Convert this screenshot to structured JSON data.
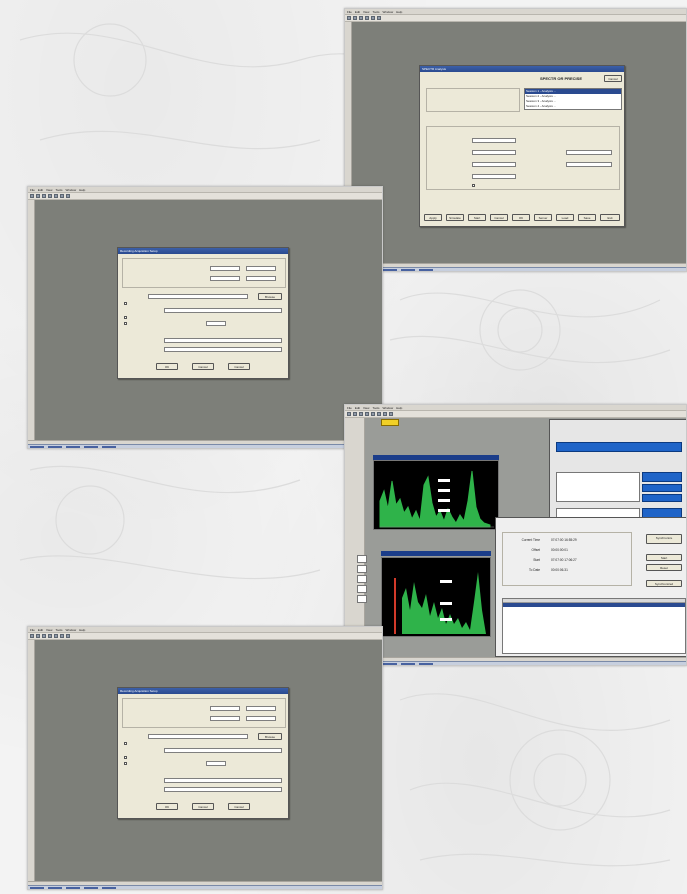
{
  "screens": {
    "top_right": {
      "dialog": {
        "title": "SPECTR Analysis",
        "heading": "SPECTR OR PRECISE",
        "cancel_label": "Cancel",
        "list_items": [
          "Session 1 - Analysis ...",
          "Session 2 - Analysis ...",
          "Session 3 - Analysis ...",
          "Session 4 - Analysis ..."
        ],
        "bottom_buttons": [
          "Apply",
          "Simulate",
          "Start",
          "Cancel",
          "OK",
          "Server",
          "Load",
          "Save",
          "Exit"
        ]
      }
    },
    "middle_left": {
      "dialog": {
        "title": "Recording Acquisition Setup",
        "ok_label": "OK",
        "cancel_label": "Cancel",
        "help_label": "Cancel",
        "browse_label": "Browse"
      }
    },
    "right_analyzer": {
      "result_panel": {
        "rows": [
          {
            "label": "Current Time",
            "value": "07:07:00 16:55:29"
          },
          {
            "label": "Offset",
            "value": "00:00:00:01"
          },
          {
            "label": "Start",
            "value": "07:07:00 17:06:27"
          },
          {
            "label": "To Date",
            "value": "00:00:06.31"
          }
        ],
        "side_buttons": [
          "Synchronize",
          "Start",
          "Reset",
          "Synchronized"
        ]
      }
    },
    "bottom_left": {
      "dialog": {
        "title": "Recording Acquisition Setup",
        "ok_label": "OK",
        "cancel_label": "Cancel",
        "help_label": "Cancel",
        "browse_label": "Browse"
      }
    }
  },
  "colors": {
    "workspace_gray": "#7d7f79",
    "dialog_face": "#ece9d8",
    "titlebar_blue": "#2a4a90",
    "spectrum_green": "#2fb34a"
  }
}
